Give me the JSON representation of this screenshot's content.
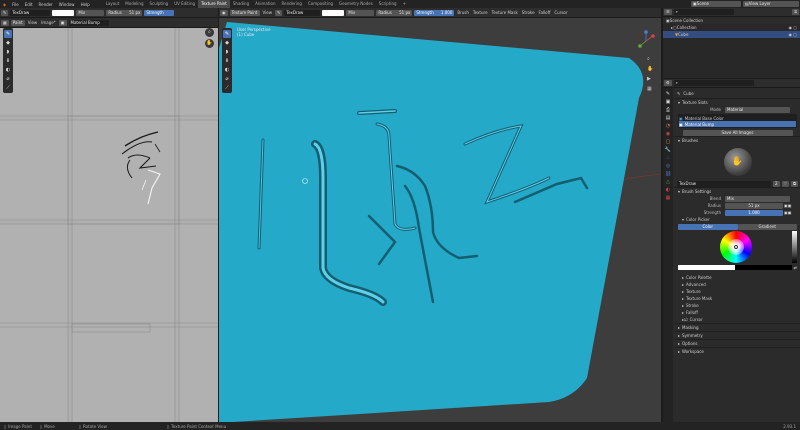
{
  "topbar": {
    "menus": [
      "File",
      "Edit",
      "Render",
      "Window",
      "Help"
    ],
    "workspace_tabs": [
      "Layout",
      "Modeling",
      "Sculpting",
      "UV Editing",
      "Texture Paint",
      "Shading",
      "Animation",
      "Rendering",
      "Compositing",
      "Geometry Nodes",
      "Scripting"
    ],
    "active_tab": "Texture Paint",
    "scene_label": "Scene",
    "view_layer_label": "View Layer"
  },
  "image_editor": {
    "brush": "TexDraw",
    "blend": "Mix",
    "radius_label": "Radius",
    "radius_value": "51 px",
    "strength_label": "Strength",
    "menus": [
      "Paint",
      "View",
      "Image*"
    ],
    "image_name": "Material Bump",
    "status": "Image Paint",
    "status2": "Move"
  },
  "viewport": {
    "mode": "Texture Paint",
    "view": "View",
    "brush": "TexDraw",
    "blend": "Mix",
    "radius_label": "Radius",
    "radius_value": "51 px",
    "strength_label": "Strength",
    "strength_value": "1.000",
    "menus": [
      "Brush",
      "Texture",
      "Texture Mask",
      "Stroke",
      "Falloff",
      "Cursor"
    ],
    "texture_slots": "Texture Slots",
    "shading": "Masking",
    "overlay_line1": "User Perspective",
    "overlay_line2": "(1) Cube",
    "object_color": "#25a9c9"
  },
  "outliner": {
    "title": "Scene Collection",
    "rows": [
      "Collection",
      "Cube"
    ]
  },
  "properties": {
    "object_name": "Cube",
    "texture_slots": {
      "header": "Texture Slots",
      "mode_label": "Mode",
      "mode_value": "Material",
      "slots": [
        "Material Base Color",
        "Material Bump"
      ],
      "save_button": "Save All Images"
    },
    "brushes": {
      "header": "Brushes",
      "name": "TexDraw",
      "users": "2"
    },
    "brush_settings": {
      "header": "Brush Settings",
      "blend_label": "Blend",
      "blend_value": "Mix",
      "radius_label": "Radius",
      "radius_value": "51 px",
      "strength_label": "Strength",
      "strength_value": "1.000"
    },
    "color_picker": {
      "header": "Color Picker",
      "tab_color": "Color",
      "tab_gradient": "Gradient"
    },
    "sub_panels": [
      "Color Palette",
      "Advanced",
      "Texture",
      "Texture Mask",
      "Stroke",
      "Falloff",
      "Cursor"
    ],
    "panels": [
      "Masking",
      "Symmetry",
      "Options",
      "Workspace"
    ]
  },
  "status_bar": {
    "items": [
      "Image Paint",
      "Move",
      "Rotate View",
      "Texture Paint Context Menu"
    ],
    "version": "2.93.1"
  }
}
